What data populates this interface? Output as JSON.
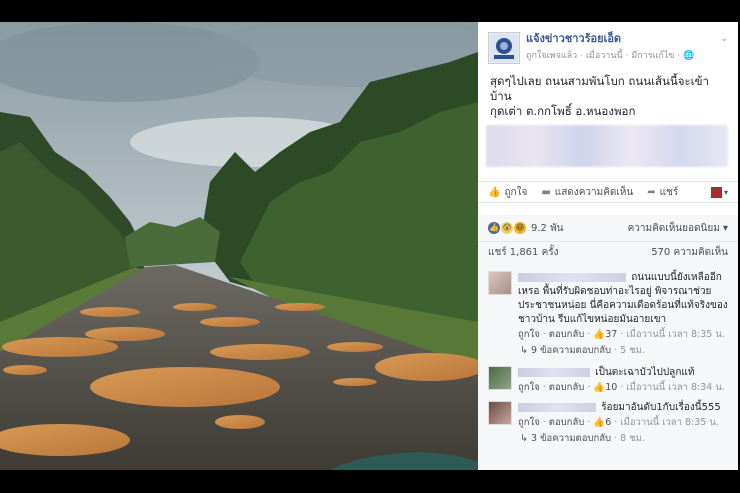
{
  "post": {
    "page_name": "แจ้งข่าวชาวร้อยเอ็ด",
    "meta_liked": "ถูกใจเพจแล้ว",
    "meta_time": "เมื่อวานนี้",
    "meta_edited": "มีการแก้ไข",
    "meta_globe": "🌐",
    "chevron": "⌄",
    "text_line1": "สุดๆไปเลย ถนนสามพันโบก ถนนเส้นนี้จะเข้าบ้าน",
    "text_line2": "กุดเต่า ต.กกโพธิ์ อ.หนองพอก"
  },
  "actions": {
    "like": "ถูกใจ",
    "comment": "แสดงความคิดเห็น",
    "share": "แชร์",
    "share_arrow": "▾"
  },
  "reactions": {
    "count": "9.2 พัน",
    "sort_label": "ความคิดเห็นยอดนิยม",
    "sort_arrow": "▾",
    "like_icon": "👍",
    "wow_icon": "😮",
    "haha_icon": "😆"
  },
  "stats": {
    "shares": "แชร์ 1,861 ครั้ง",
    "comments": "570 ความคิดเห็น"
  },
  "comments": [
    {
      "text": "ถนนแบบนี้ยังเหลืออีกเหรอ พื้นที่รับผิดชอบท่าอะไรอยู่ พิจารณาช่วยประชาชนหน่อย นี่คือความเดือดร้อนที่แท้จริงของชาวบ้าน รีบแก้ไขหน่อยมันอายเขา",
      "like": "ถูกใจ",
      "reply": "ตอบกลับ",
      "likes": "37",
      "time": "เมื่อวานนี้ เวลา 8:35 น.",
      "replies": "9 ข้อความตอบกลับ",
      "replies_time": "5 ชม."
    },
    {
      "text": "เป็นตะเฉาบัวไปปลูกแท้",
      "like": "ถูกใจ",
      "reply": "ตอบกลับ",
      "likes": "10",
      "time": "เมื่อวานนี้ เวลา 8:34 น."
    },
    {
      "text": "ร้อยมาอันดับ1กับเรื่องนี้555",
      "like": "ถูกใจ",
      "reply": "ตอบกลับ",
      "likes": "6",
      "time": "เมื่อวานนี้ เวลา 8:35 น.",
      "replies": "3 ข้อความตอบกลับ",
      "replies_time": "8 ชม."
    }
  ]
}
